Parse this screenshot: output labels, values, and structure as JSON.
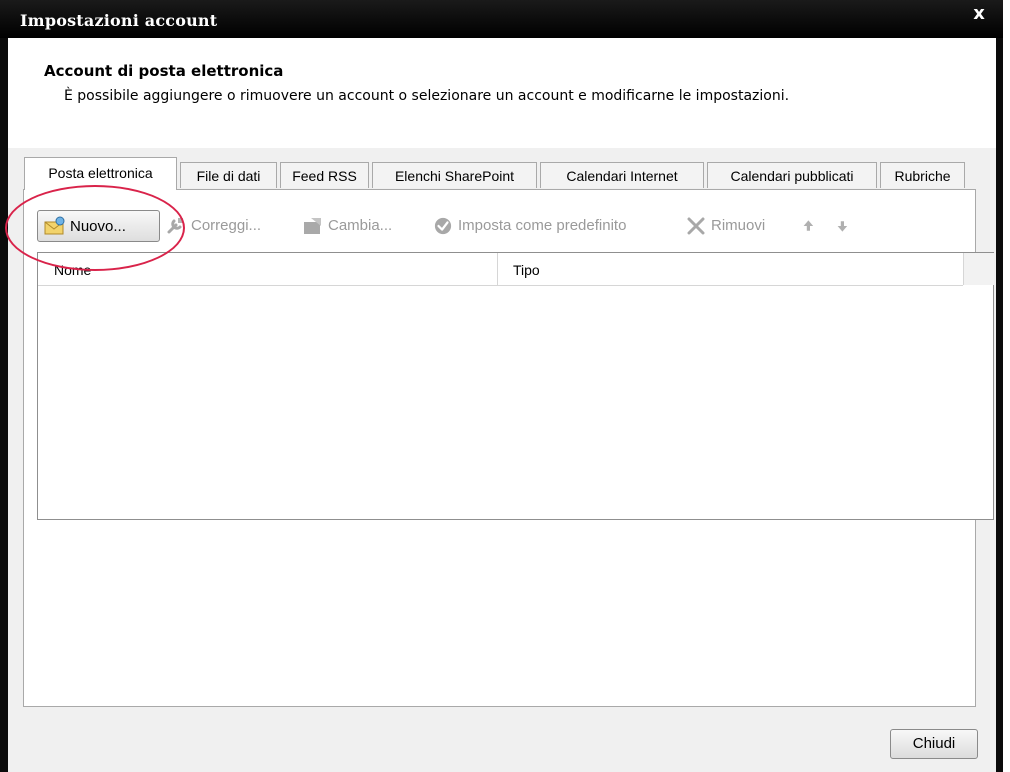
{
  "window": {
    "title": "Impostazioni account",
    "close_glyph": "x"
  },
  "header": {
    "title": "Account di posta elettronica",
    "description": "È possibile aggiungere o rimuovere un account o selezionare un account e modificarne le impostazioni."
  },
  "tabs": [
    {
      "label": "Posta elettronica",
      "active": true
    },
    {
      "label": "File di dati",
      "active": false
    },
    {
      "label": "Feed RSS",
      "active": false
    },
    {
      "label": "Elenchi SharePoint",
      "active": false
    },
    {
      "label": "Calendari Internet",
      "active": false
    },
    {
      "label": "Calendari pubblicati",
      "active": false
    },
    {
      "label": "Rubriche",
      "active": false
    }
  ],
  "toolbar": {
    "new_label": "Nuovo...",
    "repair_label": "Correggi...",
    "change_label": "Cambia...",
    "set_default_label": "Imposta come predefinito",
    "remove_label": "Rimuovi",
    "icons": {
      "new": "envelope-icon",
      "repair": "wrench-icon",
      "change": "change-icon",
      "set_default": "checkmark-icon",
      "remove": "x-icon",
      "move_up": "arrow-up-icon",
      "move_down": "arrow-down-icon"
    }
  },
  "list": {
    "columns": [
      "Nome",
      "Tipo"
    ],
    "rows": []
  },
  "footer": {
    "close_label": "Chiudi"
  },
  "colors": {
    "highlight": "#d9234a",
    "titlebar": "#000000",
    "disabled_text": "#9a9a9a"
  }
}
